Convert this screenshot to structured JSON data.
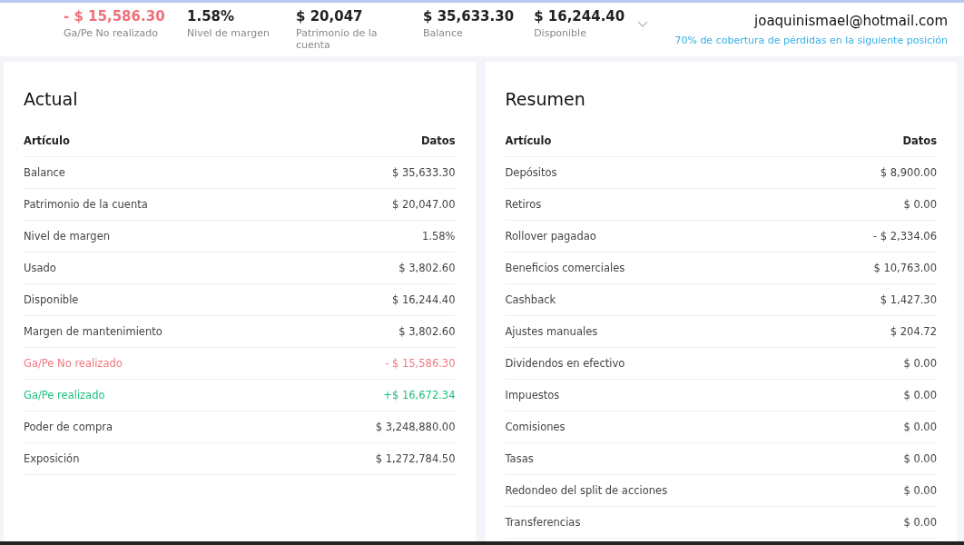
{
  "stats": [
    {
      "value": "- $ 15,586.30",
      "label": "Ga/Pe No realizado",
      "kind": "loss"
    },
    {
      "value": "1.58%",
      "label": "Nivel de margen",
      "kind": "normal"
    },
    {
      "value": "$ 20,047",
      "label": "Patrimonio de la cuenta",
      "kind": "normal"
    },
    {
      "value": "$ 35,633.30",
      "label": "Balance",
      "kind": "normal"
    },
    {
      "value": "$ 16,244.40",
      "label": "Disponible",
      "kind": "normal"
    }
  ],
  "account": {
    "email": "joaquinismael@hotmail.com",
    "coverage_note": "70% de cobertura de pérdidas en la siguiente posición"
  },
  "panels": [
    {
      "title": "Actual",
      "columns": [
        "Artículo",
        "Datos"
      ],
      "rows": [
        {
          "item": "Balance",
          "value": "$ 35,633.30",
          "kind": "normal"
        },
        {
          "item": "Patrimonio de la cuenta",
          "value": "$ 20,047.00",
          "kind": "normal"
        },
        {
          "item": "Nivel de margen",
          "value": "1.58%",
          "kind": "normal"
        },
        {
          "item": "Usado",
          "value": "$ 3,802.60",
          "kind": "normal"
        },
        {
          "item": "Disponible",
          "value": "$ 16,244.40",
          "kind": "normal"
        },
        {
          "item": "Margen de mantenimiento",
          "value": "$ 3,802.60",
          "kind": "normal"
        },
        {
          "item": "Ga/Pe No realizado",
          "value": "- $ 15,586.30",
          "kind": "loss"
        },
        {
          "item": "Ga/Pe realizado",
          "value": "+$ 16,672.34",
          "kind": "gain"
        },
        {
          "item": "Poder de compra",
          "value": "$ 3,248,880.00",
          "kind": "normal"
        },
        {
          "item": "Exposición",
          "value": "$ 1,272,784.50",
          "kind": "normal"
        }
      ]
    },
    {
      "title": "Resumen",
      "columns": [
        "Artículo",
        "Datos"
      ],
      "rows": [
        {
          "item": "Depósitos",
          "value": "$ 8,900.00",
          "kind": "normal"
        },
        {
          "item": "Retiros",
          "value": "$ 0.00",
          "kind": "normal"
        },
        {
          "item": "Rollover pagadao",
          "value": "- $ 2,334.06",
          "kind": "normal"
        },
        {
          "item": "Beneficios comerciales",
          "value": "$ 10,763.00",
          "kind": "normal"
        },
        {
          "item": "Cashback",
          "value": "$ 1,427.30",
          "kind": "normal"
        },
        {
          "item": "Ajustes manuales",
          "value": "$ 204.72",
          "kind": "normal"
        },
        {
          "item": "Dividendos en efectivo",
          "value": "$ 0.00",
          "kind": "normal"
        },
        {
          "item": "Impuestos",
          "value": "$ 0.00",
          "kind": "normal"
        },
        {
          "item": "Comisiones",
          "value": "$ 0.00",
          "kind": "normal"
        },
        {
          "item": "Tasas",
          "value": "$ 0.00",
          "kind": "normal"
        },
        {
          "item": "Redondeo del split de acciones",
          "value": "$ 0.00",
          "kind": "normal"
        },
        {
          "item": "Transferencias",
          "value": "$ 0.00",
          "kind": "normal"
        }
      ]
    }
  ]
}
